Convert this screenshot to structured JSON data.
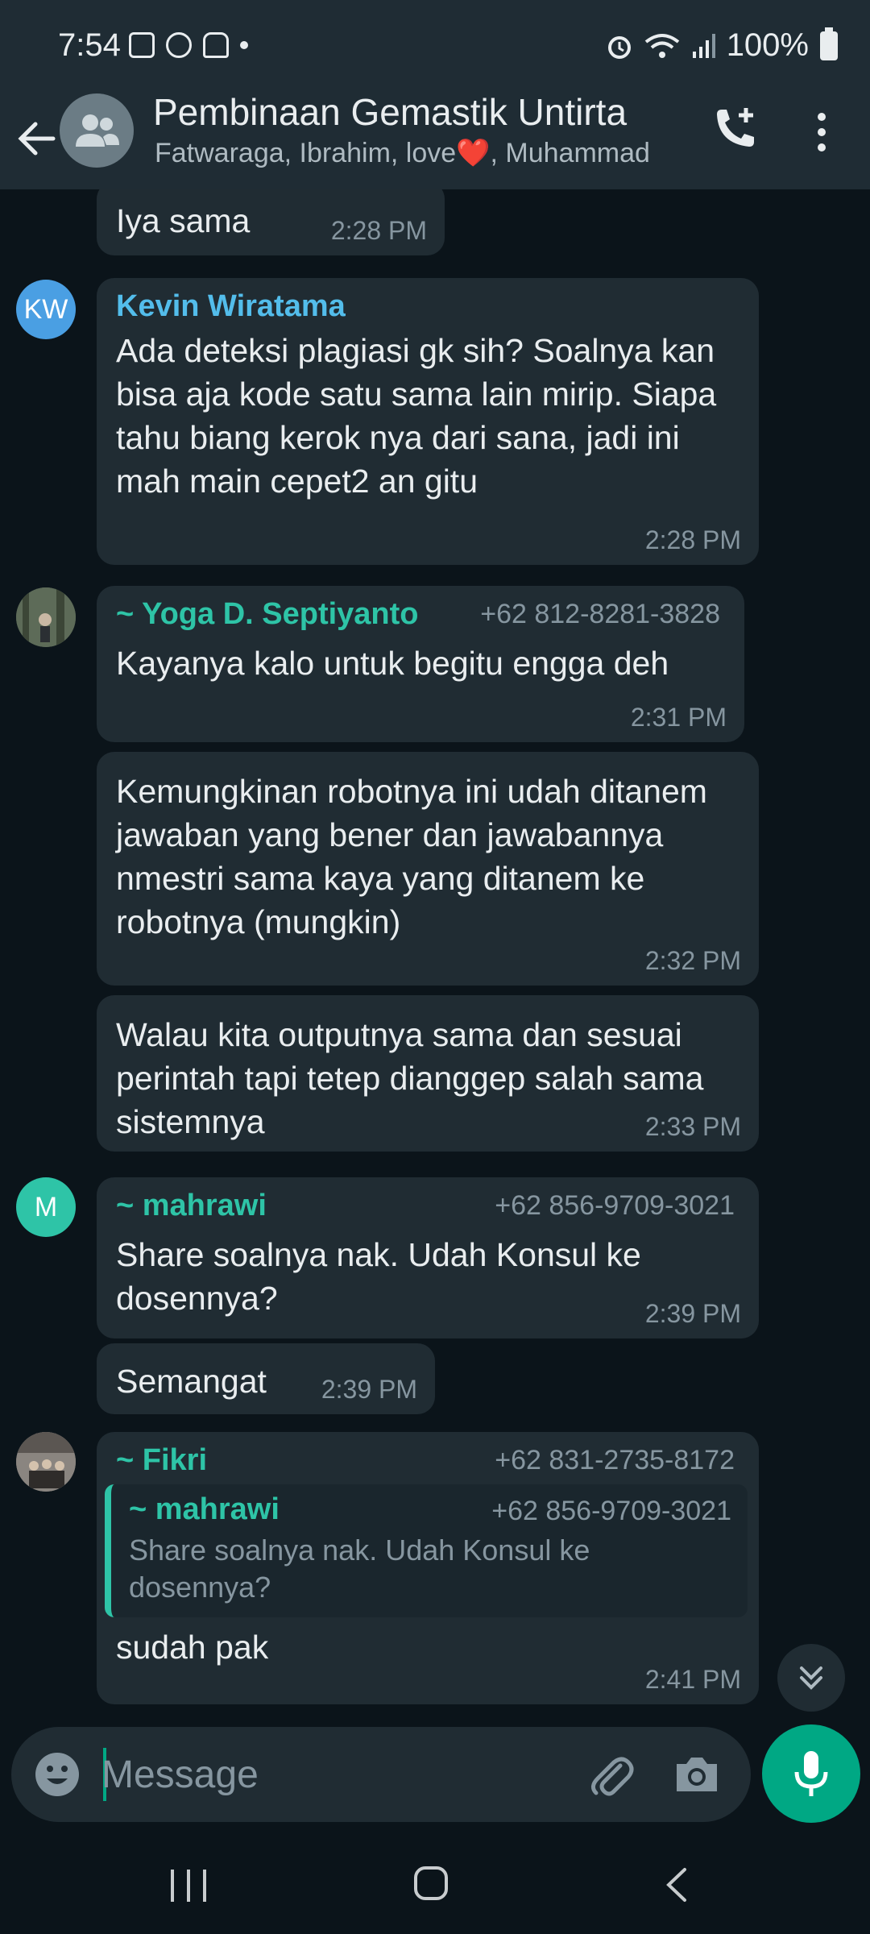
{
  "status_bar": {
    "time": "7:54",
    "battery": "100%"
  },
  "header": {
    "title": "Pembinaan Gemastik Untirta",
    "subtitle": "Fatwaraga, Ibrahim, love❤️, Muhammad"
  },
  "messages": [
    {
      "text": "Iya sama",
      "time": "2:28 PM"
    },
    {
      "avatar": "KW",
      "sender": "Kevin Wiratama",
      "text": "Ada deteksi plagiasi gk sih? Soalnya kan bisa aja kode satu sama lain mirip. Siapa tahu biang kerok nya dari sana, jadi ini mah main cepet2 an gitu",
      "time": "2:28 PM"
    },
    {
      "sender": "~ Yoga D. Septiyanto",
      "phone": "+62 812-8281-3828",
      "text": "Kayanya kalo untuk begitu engga deh",
      "time": "2:31 PM"
    },
    {
      "text": "Kemungkinan robotnya ini udah ditanem jawaban yang bener dan jawabannya nmestri sama kaya yang ditanem ke robotnya (mungkin)",
      "time": "2:32 PM"
    },
    {
      "text": "Walau kita outputnya sama dan sesuai perintah tapi tetep dianggep salah sama sistemnya",
      "time": "2:33 PM"
    },
    {
      "avatar": "M",
      "sender": "~ mahrawi",
      "phone": "+62 856-9709-3021",
      "text": "Share soalnya nak. Udah Konsul ke dosennya?",
      "time": "2:39 PM"
    },
    {
      "text": "Semangat",
      "time": "2:39 PM"
    },
    {
      "sender": "~ Fikri",
      "phone": "+62 831-2735-8172",
      "quote": {
        "sender": "~ mahrawi",
        "phone": "+62 856-9709-3021",
        "text": "Share soalnya nak. Udah Konsul ke dosennya?"
      },
      "text": "sudah pak",
      "time": "2:41 PM"
    }
  ],
  "input": {
    "placeholder": "Message"
  },
  "colors": {
    "background": "#0b141a",
    "bar": "#1f2c34",
    "bubble": "#202c33",
    "accent": "#00a884",
    "name_kevin": "#53bdeb",
    "name_green": "#2ec4a7"
  }
}
